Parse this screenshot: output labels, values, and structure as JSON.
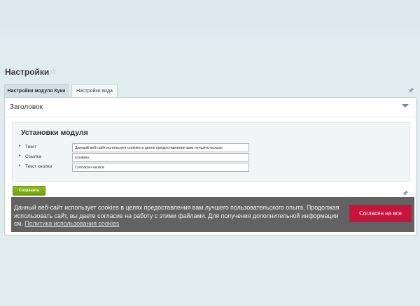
{
  "page": {
    "title": "Настройки",
    "favorite_icon": "star-icon"
  },
  "tabs": [
    {
      "label": "Настройки модуля Куки",
      "active": true
    },
    {
      "label": "Настройки вида",
      "active": false
    }
  ],
  "panel": {
    "header": "Заголовок",
    "collapse_icon": "chevron-down-icon",
    "module_title": "Установки модуля",
    "fields": [
      {
        "label": "Текст",
        "value": "Данный веб-сайт использует cookies в целях предоставления вам лучшего пользо"
      },
      {
        "label": "Ссылка",
        "value": "/cookies"
      },
      {
        "label": "Текст кнопки",
        "value": "Согласен на все"
      }
    ],
    "save_label": "Сохранить",
    "pin_icon": "pin-icon"
  },
  "cookie_banner": {
    "text": "Данный веб-сайт использует cookies в целях предоставления вам лучшего пользовательского опыта. Продолжая использовать сайт, вы даете согласие на работу с этими файлами. Для получения дополнительной информации см.",
    "link_label": "Политика использования cookies",
    "accept_label": "Согласен на все"
  },
  "colors": {
    "background": "#e1ecef",
    "save_button": "#7fae18",
    "accept_button": "#c8143c",
    "banner": "#555555"
  }
}
